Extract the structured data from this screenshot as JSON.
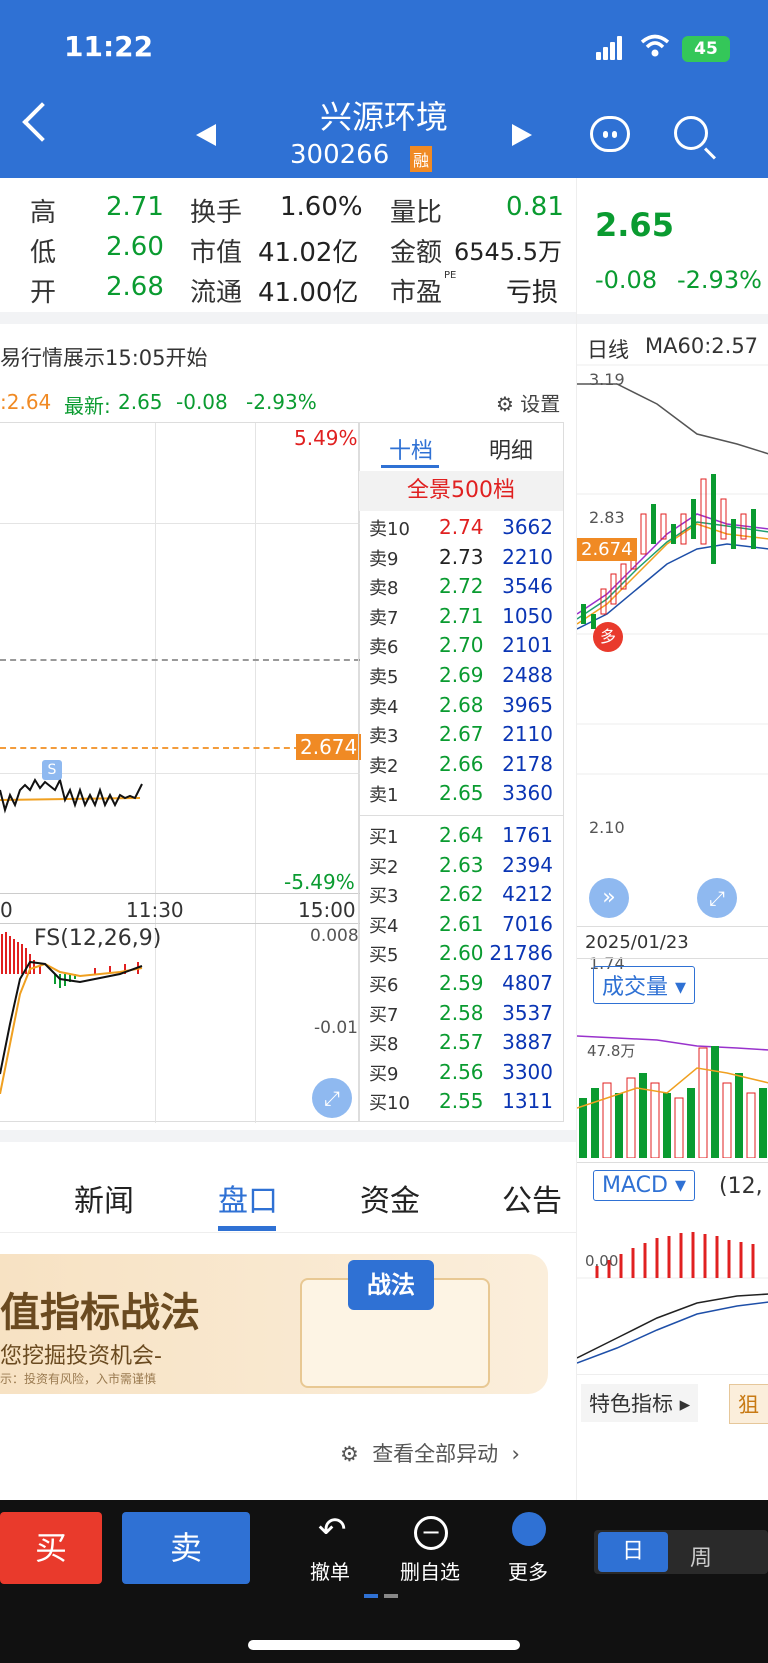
{
  "status": {
    "time": "11:22",
    "battery": "45"
  },
  "header": {
    "title": "兴源环境",
    "code": "300266",
    "badge": "融"
  },
  "stats": {
    "high_label": "高",
    "high": "2.71",
    "low_label": "低",
    "low": "2.60",
    "open_label": "开",
    "open": "2.68",
    "turnover_label": "换手",
    "turnover": "1.60%",
    "mktcap_label": "市值",
    "mktcap": "41.02亿",
    "float_label": "流通",
    "float": "41.00亿",
    "volratio_label": "量比",
    "volratio": "0.81",
    "amount_label": "金额",
    "amount": "6545.5万",
    "pe_label": "市盈",
    "pe_sup": "PE",
    "pe": "亏损"
  },
  "right_price": {
    "price": "2.65",
    "change": "-0.08",
    "pct": "-2.93%"
  },
  "intraday": {
    "notice": "易行情展示15:05开始",
    "avg_prefix": ":2.64",
    "latest_label": "最新:",
    "latest": "2.65",
    "change": "-0.08",
    "pct": "-2.93%",
    "settings": "设置",
    "top_pct": "5.49%",
    "bottom_pct": "-5.49%",
    "ref_tag": "2.674",
    "time_ticks": [
      "0",
      "11:30",
      "15:00"
    ],
    "s_marker": "S",
    "macd_label": "FS(12,26,9)",
    "macd_top": "0.008",
    "macd_mid": "-0.01"
  },
  "orderbook": {
    "tabs": [
      "十档",
      "明细"
    ],
    "panorama": "全景500档",
    "asks": [
      {
        "k": "卖10",
        "p": "2.74",
        "v": "3662",
        "c": "red"
      },
      {
        "k": "卖9",
        "p": "2.73",
        "v": "2210",
        "c": "blk"
      },
      {
        "k": "卖8",
        "p": "2.72",
        "v": "3546",
        "c": "grn"
      },
      {
        "k": "卖7",
        "p": "2.71",
        "v": "1050",
        "c": "grn"
      },
      {
        "k": "卖6",
        "p": "2.70",
        "v": "2101",
        "c": "grn"
      },
      {
        "k": "卖5",
        "p": "2.69",
        "v": "2488",
        "c": "grn"
      },
      {
        "k": "卖4",
        "p": "2.68",
        "v": "3965",
        "c": "grn"
      },
      {
        "k": "卖3",
        "p": "2.67",
        "v": "2110",
        "c": "grn"
      },
      {
        "k": "卖2",
        "p": "2.66",
        "v": "2178",
        "c": "grn"
      },
      {
        "k": "卖1",
        "p": "2.65",
        "v": "3360",
        "c": "grn"
      }
    ],
    "bids": [
      {
        "k": "买1",
        "p": "2.64",
        "v": "1761",
        "c": "grn"
      },
      {
        "k": "买2",
        "p": "2.63",
        "v": "2394",
        "c": "grn"
      },
      {
        "k": "买3",
        "p": "2.62",
        "v": "4212",
        "c": "grn"
      },
      {
        "k": "买4",
        "p": "2.61",
        "v": "7016",
        "c": "grn"
      },
      {
        "k": "买5",
        "p": "2.60",
        "v": "21786",
        "c": "grn"
      },
      {
        "k": "买6",
        "p": "2.59",
        "v": "4807",
        "c": "grn"
      },
      {
        "k": "买7",
        "p": "2.58",
        "v": "3537",
        "c": "grn"
      },
      {
        "k": "买8",
        "p": "2.57",
        "v": "3887",
        "c": "grn"
      },
      {
        "k": "买9",
        "p": "2.56",
        "v": "3300",
        "c": "grn"
      },
      {
        "k": "买10",
        "p": "2.55",
        "v": "1311",
        "c": "grn"
      }
    ]
  },
  "tabs": [
    "新闻",
    "盘口",
    "资金",
    "公告"
  ],
  "banner": {
    "title": "值指标战法",
    "subtitle": "您挖掘投资机会-",
    "note": "示：投资有风险，入市需谨慎",
    "badge": "战法"
  },
  "view_all": "查看全部异动",
  "kline": {
    "label": "日线",
    "ma60": "MA60:2.57",
    "y_top": "3.19",
    "y_2": "2.83",
    "y_tag": "2.674",
    "y_3": "2.1",
    "y_4": "2.10",
    "y_bot": "1.74",
    "date": "2025/01/23",
    "duo": "多",
    "vol_btn": "成交量",
    "vol_val": "47.8万",
    "macd_btn": "MACD",
    "macd_params": "(12,",
    "macd_zero": "0.00",
    "feature": "特色指标",
    "feature2": "狙"
  },
  "period_tabs": [
    "日",
    "周"
  ],
  "footer": {
    "buy": "买",
    "sell": "卖",
    "cancel": "撤单",
    "remove": "删自选",
    "more": "更多"
  },
  "colors": {
    "header": "#2f71d4",
    "green": "#0a9b30",
    "red": "#e02020",
    "orange": "#f08a24"
  }
}
